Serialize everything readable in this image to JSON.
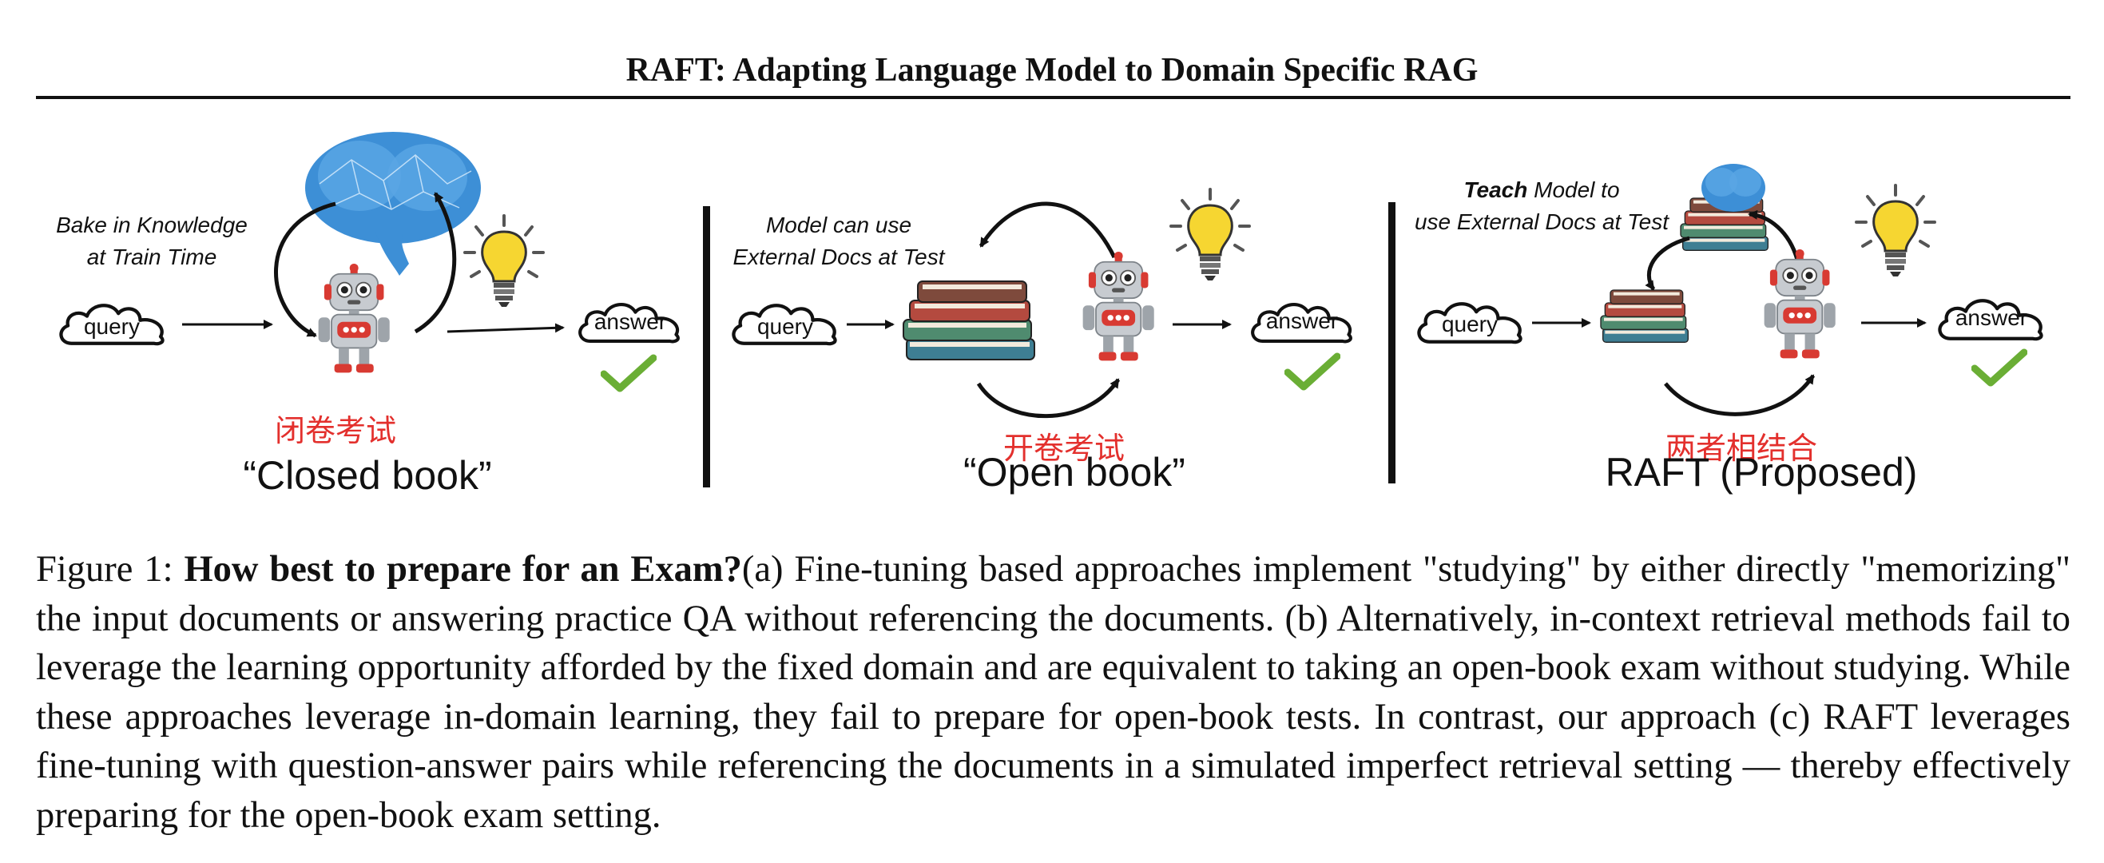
{
  "paper": {
    "title": "RAFT: Adapting Language Model to Domain Specific RAG"
  },
  "figure": {
    "labels": {
      "query": "query",
      "answer": "answer"
    },
    "panel_closed": {
      "note_line1": "Bake in Knowledge",
      "note_line2": "at Train Time",
      "chinese_label": "闭卷考试",
      "caption": "“Closed book”"
    },
    "panel_open": {
      "note_line1": "Model can use",
      "note_line2": "External Docs at Test",
      "chinese_label": "开卷考试",
      "caption": "“Open book”"
    },
    "panel_raft": {
      "note_line1_bold": "Teach",
      "note_line1_rest": " Model to",
      "note_line2": "use External Docs at Test",
      "chinese_label": "两者相结合",
      "caption": "RAFT (Proposed)"
    },
    "colors": {
      "check": "#6aae35",
      "chinese_text": "#e3302d",
      "brain": "#3d8fd6",
      "bulb": "#f6d631",
      "robot_red": "#d83a32",
      "robot_gray": "#9ea4aa"
    },
    "icons": [
      "query-cloud-icon",
      "answer-cloud-icon",
      "robot-icon",
      "brain-icon",
      "lightbulb-icon",
      "books-icon",
      "checkmark-icon"
    ]
  },
  "caption": {
    "label": "Figure 1:",
    "bold": "How best to prepare for an Exam?",
    "text": "(a) Fine-tuning based approaches implement \"studying\" by either directly \"memorizing\" the input documents or answering practice QA without referencing the documents. (b) Alternatively, in-context retrieval methods fail to leverage the learning opportunity afforded by the fixed domain and are equivalent to taking an open-book exam without studying. While these approaches leverage in-domain learning, they fail to prepare for open-book tests. In contrast, our approach (c) RAFT leverages fine-tuning with question-answer pairs while referencing the documents in a simulated imperfect retrieval setting — thereby effectively preparing for the open-book exam setting."
  }
}
